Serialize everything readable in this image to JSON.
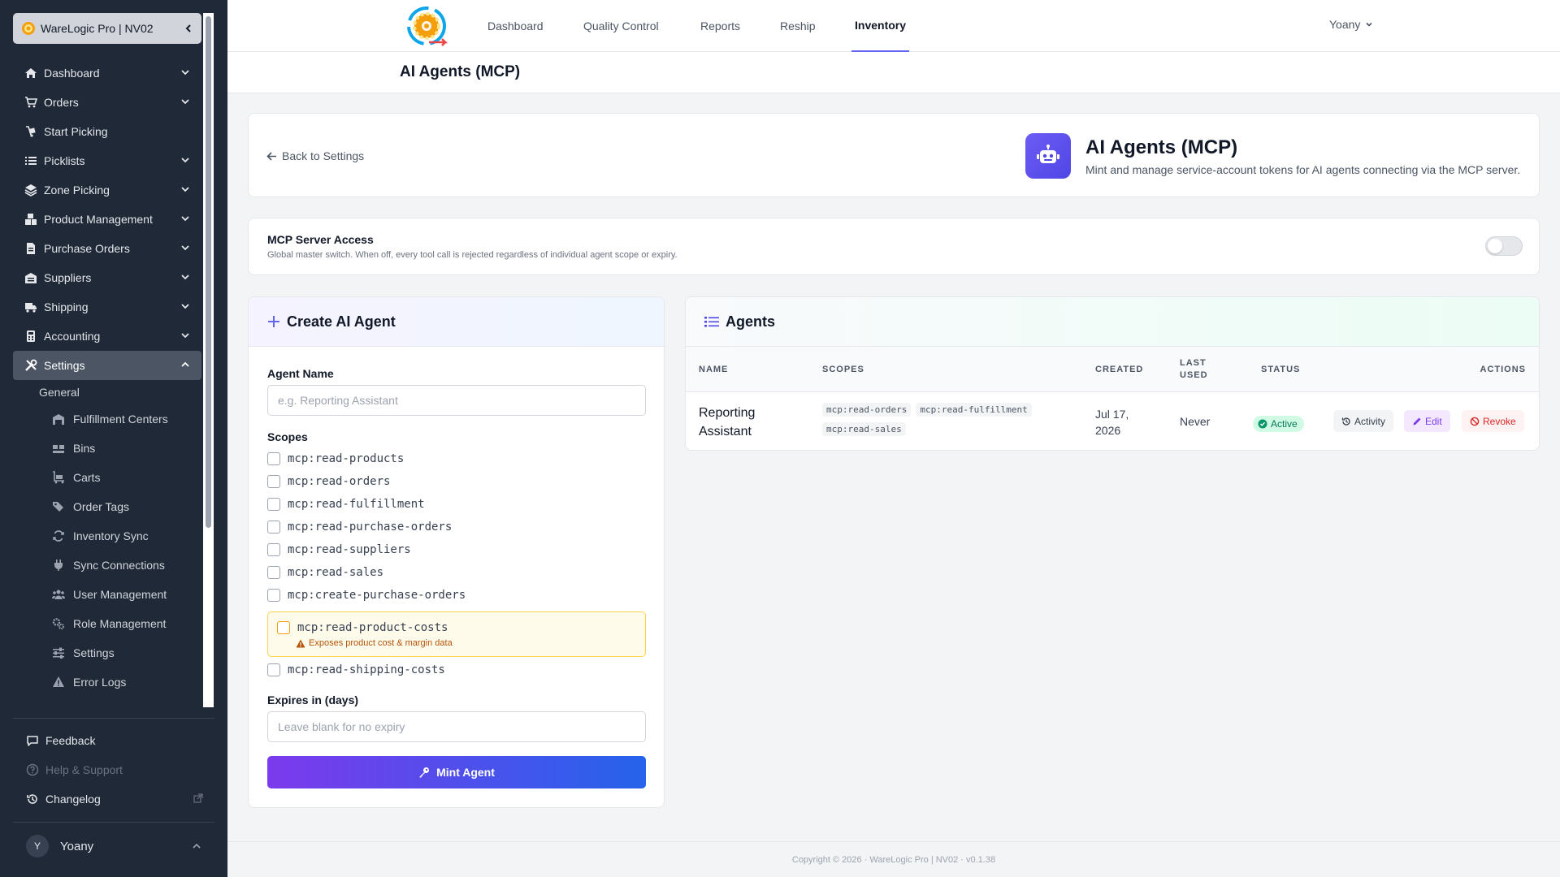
{
  "sidebar": {
    "brand": "WareLogic Pro | NV02",
    "items": [
      {
        "label": "Dashboard",
        "icon": "home-icon"
      },
      {
        "label": "Orders",
        "icon": "cart-icon"
      },
      {
        "label": "Start Picking",
        "icon": "dolly-icon"
      },
      {
        "label": "Picklists",
        "icon": "list-icon"
      },
      {
        "label": "Zone Picking",
        "icon": "layers-icon"
      },
      {
        "label": "Product Management",
        "icon": "boxes-icon"
      },
      {
        "label": "Purchase Orders",
        "icon": "file-icon"
      },
      {
        "label": "Suppliers",
        "icon": "warehouse-icon"
      },
      {
        "label": "Shipping",
        "icon": "truck-icon"
      },
      {
        "label": "Accounting",
        "icon": "calculator-icon"
      },
      {
        "label": "Settings",
        "icon": "tools-icon"
      }
    ],
    "group_label": "General",
    "sub_items": [
      {
        "label": "Fulfillment Centers",
        "icon": "building-icon"
      },
      {
        "label": "Bins",
        "icon": "boxes-icon"
      },
      {
        "label": "Carts",
        "icon": "cart-flatbed-icon"
      },
      {
        "label": "Order Tags",
        "icon": "tags-icon"
      },
      {
        "label": "Inventory Sync",
        "icon": "sync-icon"
      },
      {
        "label": "Sync Connections",
        "icon": "plug-icon"
      },
      {
        "label": "User Management",
        "icon": "users-icon"
      },
      {
        "label": "Role Management",
        "icon": "gears-icon"
      },
      {
        "label": "Settings",
        "icon": "sliders-icon"
      },
      {
        "label": "Error Logs",
        "icon": "warning-icon"
      }
    ],
    "footer": [
      {
        "label": "Feedback",
        "icon": "comment-icon"
      },
      {
        "label": "Help & Support",
        "icon": "question-icon"
      },
      {
        "label": "Changelog",
        "icon": "history-icon"
      }
    ],
    "user": {
      "initial": "Y",
      "name": "Yoany"
    }
  },
  "topnav": {
    "tabs": [
      "Dashboard",
      "Quality Control",
      "Reports",
      "Reship",
      "Inventory"
    ],
    "active_tab": "Inventory",
    "user": "Yoany"
  },
  "page_title": "AI Agents (MCP)",
  "header_card": {
    "back_label": "Back to Settings",
    "title": "AI Agents (MCP)",
    "subtitle": "Mint and manage service-account tokens for AI agents connecting via the MCP server."
  },
  "mcp_access": {
    "title": "MCP Server Access",
    "description": "Global master switch. When off, every tool call is rejected regardless of individual agent scope or expiry.",
    "enabled": false
  },
  "create_form": {
    "title": "Create AI Agent",
    "name_label": "Agent Name",
    "name_placeholder": "e.g. Reporting Assistant",
    "scopes_label": "Scopes",
    "scopes": [
      "mcp:read-products",
      "mcp:read-orders",
      "mcp:read-fulfillment",
      "mcp:read-purchase-orders",
      "mcp:read-suppliers",
      "mcp:read-sales",
      "mcp:create-purchase-orders",
      "mcp:read-product-costs",
      "mcp:read-shipping-costs"
    ],
    "cost_warning": "Exposes product cost & margin data",
    "expires_label": "Expires in (days)",
    "expires_placeholder": "Leave blank for no expiry",
    "submit_label": "Mint Agent"
  },
  "agents": {
    "title": "Agents",
    "columns": {
      "name": "NAME",
      "scopes": "SCOPES",
      "created": "CREATED",
      "last_used_1": "LAST",
      "last_used_2": "USED",
      "status": "STATUS",
      "actions": "ACTIONS"
    },
    "rows": [
      {
        "name_1": "Reporting",
        "name_2": "Assistant",
        "scopes": [
          "mcp:read-orders",
          "mcp:read-fulfillment",
          "mcp:read-sales"
        ],
        "created_1": "Jul 17,",
        "created_2": "2026",
        "last_used": "Never",
        "status": "Active",
        "actions": {
          "activity": "Activity",
          "edit": "Edit",
          "revoke": "Revoke"
        }
      }
    ]
  },
  "footer": "Copyright © 2026 · WareLogic Pro | NV02 · v0.1.38",
  "colors": {
    "sidebar": "#1f2937",
    "accent": "#6366f1",
    "active_green": "#047857",
    "revoke_red": "#dc2626",
    "edit_purple": "#7c3aed"
  }
}
